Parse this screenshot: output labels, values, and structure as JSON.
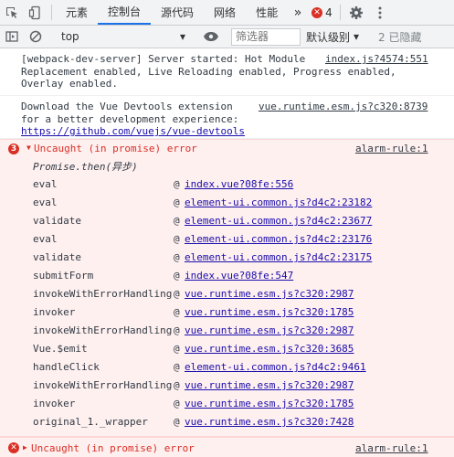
{
  "tabs": {
    "items": [
      {
        "label": "元素"
      },
      {
        "label": "控制台",
        "active": true
      },
      {
        "label": "源代码"
      },
      {
        "label": "网络"
      },
      {
        "label": "性能"
      }
    ],
    "more": "»",
    "error_count": "4"
  },
  "toolbar": {
    "context": "top",
    "filter_placeholder": "筛选器",
    "level": "默认级别",
    "hidden": "2 已隐藏"
  },
  "messages": [
    {
      "text": "[webpack-dev-server] Server started: Hot Module\nReplacement enabled, Live Reloading enabled, Progress enabled,\nOverlay enabled.",
      "source": "index.js?4574:551"
    },
    {
      "text": "Download the Vue Devtools extension\nfor a better development experience:",
      "link": "https://github.com/vuejs/vue-devtools",
      "source": "vue.runtime.esm.js?c320:8739"
    }
  ],
  "error": {
    "badge": "3",
    "title": "Uncaught (in promise) error",
    "source": "alarm-rule:1",
    "promise_line": "Promise.then(异步)",
    "frames": [
      {
        "fn": "eval",
        "loc": "index.vue?08fe:556"
      },
      {
        "fn": "eval",
        "loc": "element-ui.common.js?d4c2:23182"
      },
      {
        "fn": "validate",
        "loc": "element-ui.common.js?d4c2:23677"
      },
      {
        "fn": "eval",
        "loc": "element-ui.common.js?d4c2:23176"
      },
      {
        "fn": "validate",
        "loc": "element-ui.common.js?d4c2:23175"
      },
      {
        "fn": "submitForm",
        "loc": "index.vue?08fe:547"
      },
      {
        "fn": "invokeWithErrorHandling",
        "loc": "vue.runtime.esm.js?c320:2987"
      },
      {
        "fn": "invoker",
        "loc": "vue.runtime.esm.js?c320:1785"
      },
      {
        "fn": "invokeWithErrorHandling",
        "loc": "vue.runtime.esm.js?c320:2987"
      },
      {
        "fn": "Vue.$emit",
        "loc": "vue.runtime.esm.js?c320:3685"
      },
      {
        "fn": "handleClick",
        "loc": "element-ui.common.js?d4c2:9461"
      },
      {
        "fn": "invokeWithErrorHandling",
        "loc": "vue.runtime.esm.js?c320:2987"
      },
      {
        "fn": "invoker",
        "loc": "vue.runtime.esm.js?c320:1785"
      },
      {
        "fn": "original_1._wrapper",
        "loc": "vue.runtime.esm.js?c320:7428"
      }
    ],
    "at": "@"
  },
  "error2": {
    "title": "Uncaught (in promise) error",
    "source": "alarm-rule:1"
  }
}
